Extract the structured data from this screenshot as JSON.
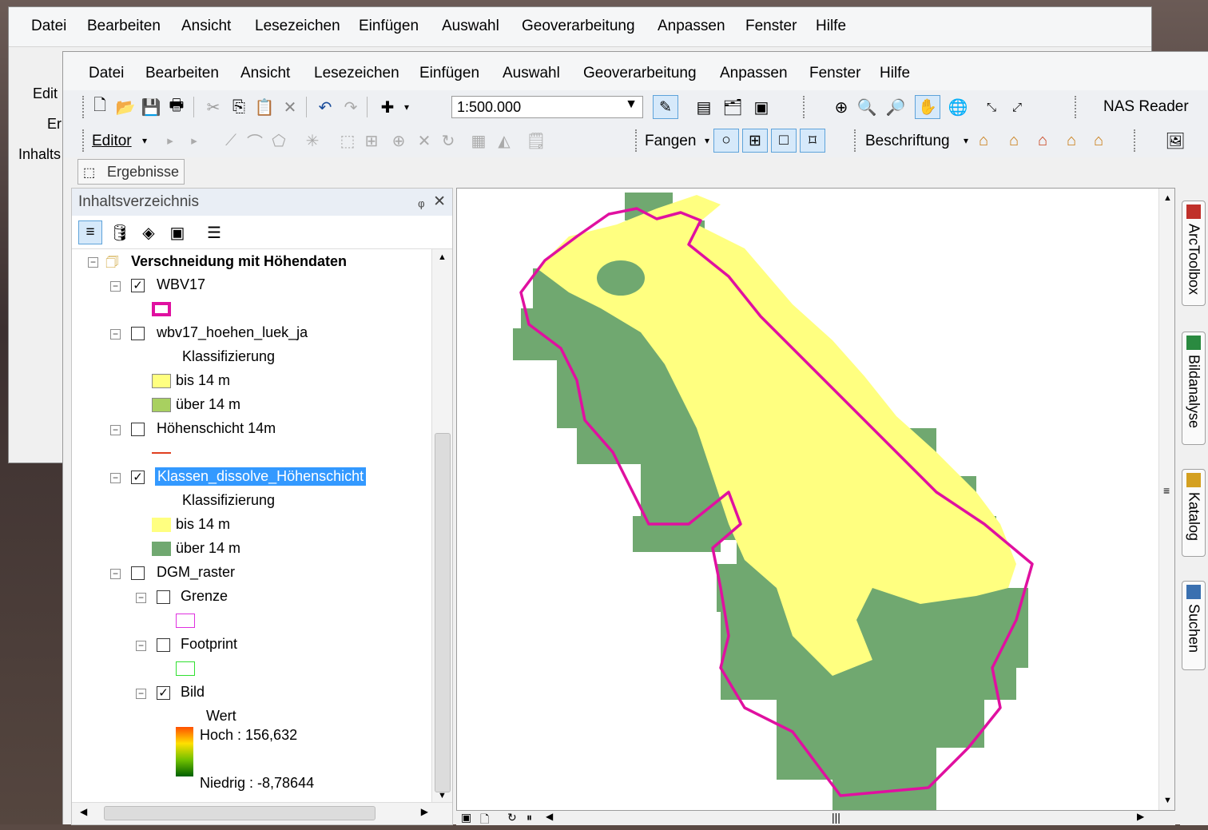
{
  "back_window": {
    "menu": [
      "Datei",
      "Bearbeiten",
      "Ansicht",
      "Lesezeichen",
      "Einfügen",
      "Auswahl",
      "Geoverarbeitung",
      "Anpassen",
      "Fenster",
      "Hilfe"
    ],
    "left_labels": [
      "Edit",
      "Er",
      "Inhalts"
    ]
  },
  "menu": [
    "Datei",
    "Bearbeiten",
    "Ansicht",
    "Lesezeichen",
    "Einfügen",
    "Auswahl",
    "Geoverarbeitung",
    "Anpassen",
    "Fenster",
    "Hilfe"
  ],
  "toolbar": {
    "scale": "1:500.000",
    "nas_reader": "NAS Reader",
    "editor": "Editor",
    "fangen": "Fangen",
    "beschriftung": "Beschriftung",
    "ergebnisse": "Ergebnisse"
  },
  "toc": {
    "title": "Inhaltsverzeichnis",
    "group": "Verschneidung mit Höhendaten",
    "layers": {
      "wbv17": "WBV17",
      "hoehen": "wbv17_hoehen_luek_ja",
      "hoehen_class": "Klassifizierung",
      "hoehen_bis": "bis 14 m",
      "hoehen_ueber": "über 14 m",
      "hoehenschicht": "Höhenschicht 14m",
      "klassen": "Klassen_dissolve_Höhenschicht",
      "klassen_class": "Klassifizierung",
      "klassen_bis": "bis 14 m",
      "klassen_ueber": "über 14 m",
      "dgm": "DGM_raster",
      "grenze": "Grenze",
      "footprint": "Footprint",
      "bild": "Bild",
      "wert": "Wert",
      "hoch": "Hoch : 156,632",
      "niedrig": "Niedrig : -8,78644"
    }
  },
  "dock": [
    "ArcToolbox",
    "Bildanalyse",
    "Katalog",
    "Suchen"
  ],
  "colors": {
    "yellow": "#ffff80",
    "green": "#70a870",
    "boundary": "#e010a0",
    "selection": "#3399ff"
  }
}
